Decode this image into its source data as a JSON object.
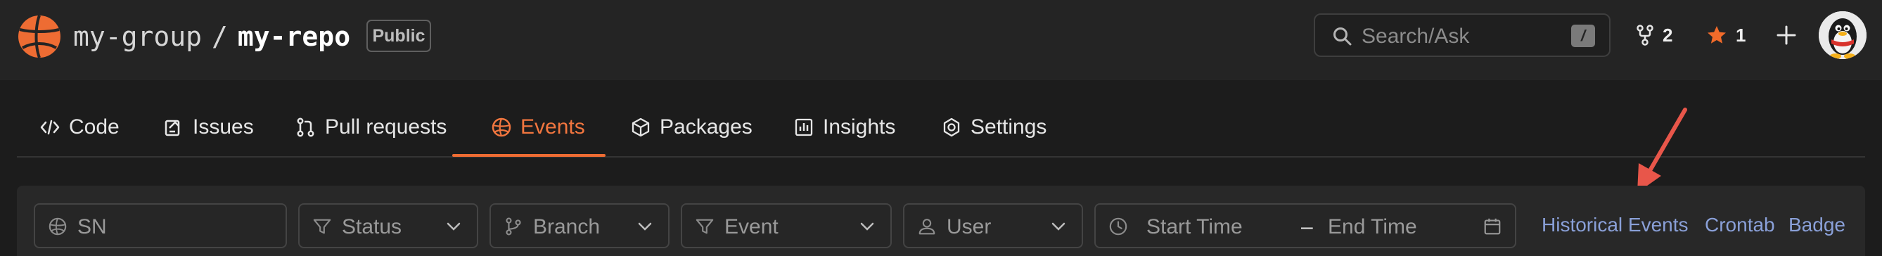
{
  "header": {
    "group": "my-group",
    "separator": "/",
    "repo": "my-repo",
    "visibility": "Public",
    "search_placeholder": "Search/Ask",
    "search_shortcut": "/",
    "forks": "2",
    "stars": "1"
  },
  "tabs": [
    {
      "label": "Code",
      "icon": "code-icon"
    },
    {
      "label": "Issues",
      "icon": "issue-icon"
    },
    {
      "label": "Pull requests",
      "icon": "pull-request-icon"
    },
    {
      "label": "Events",
      "icon": "events-icon",
      "active": true
    },
    {
      "label": "Packages",
      "icon": "package-icon"
    },
    {
      "label": "Insights",
      "icon": "insights-icon"
    },
    {
      "label": "Settings",
      "icon": "settings-icon"
    }
  ],
  "filters": {
    "sn_placeholder": "SN",
    "status": "Status",
    "branch": "Branch",
    "event": "Event",
    "user": "User",
    "start_time": "Start Time",
    "range_sep": "–",
    "end_time": "End Time"
  },
  "links": {
    "historical": "Historical Events",
    "crontab": "Crontab",
    "badge": "Badge"
  },
  "colors": {
    "accent": "#ee6c33",
    "link": "#8aa0d8",
    "annotation_arrow": "#e8564a",
    "star": "#f26b2a"
  }
}
